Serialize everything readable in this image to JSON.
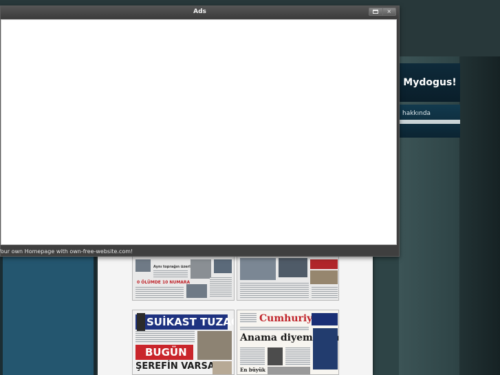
{
  "popup": {
    "title": "Ads",
    "footer_text": "Your own Homepage with own-free-website.com!",
    "buttons": {
      "maximize_icon": "maximize-icon",
      "close_label": "×"
    }
  },
  "site": {
    "brand": "Mydogus!",
    "nav": [
      {
        "label": "hakkında"
      }
    ]
  },
  "newspapers": [
    {
      "headline_1": "0 ÖLÜMDE 10 NUMARA",
      "headline_2": "Aynı toprağın üzerlenler"
    },
    {
      "headline_1": ""
    },
    {
      "headline_1": "SUİKAST TUZAĞI",
      "headline_2": "BUGÜN",
      "headline_3": "ŞEREFİN VARSA"
    },
    {
      "headline_1": "Cumhuriyet",
      "headline_2": "Anama diyemedim",
      "headline_3": "En büyük"
    }
  ],
  "colors": {
    "accent_red": "#c0252b",
    "accent_navy": "#1e3280",
    "brand_bg": "#0e2a3a"
  }
}
